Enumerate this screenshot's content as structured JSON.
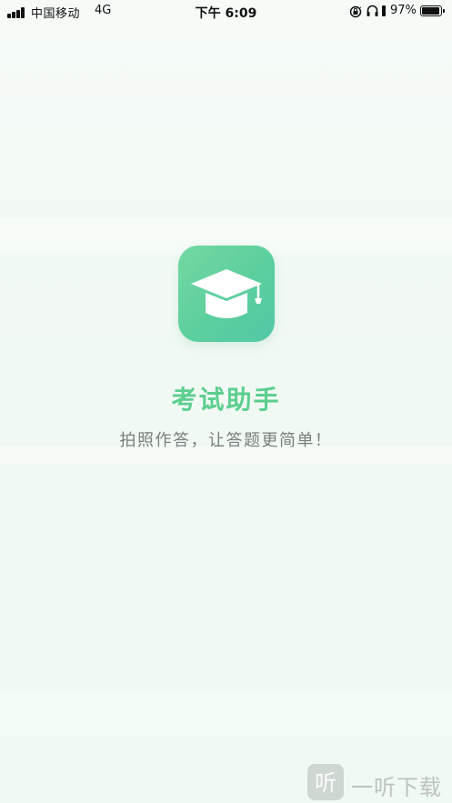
{
  "status_bar": {
    "carrier": "中国移动",
    "network": "4G",
    "time": "下午 6:09",
    "battery_percent": "97%",
    "battery_level": 0.97,
    "icons": [
      "signal-icon",
      "rotation-lock-icon",
      "headphones-icon",
      "battery-icon"
    ]
  },
  "splash": {
    "logo_icon": "graduation-cap-icon",
    "title": "考试助手",
    "slogan": "拍照作答，让答题更简单！",
    "colors": {
      "title": "#5ccf8e",
      "logo_start": "#74d8a2",
      "logo_end": "#52c8a6",
      "slogan": "#7a7f7c"
    }
  },
  "watermark": {
    "glyph": "听",
    "text": "一听下载"
  }
}
